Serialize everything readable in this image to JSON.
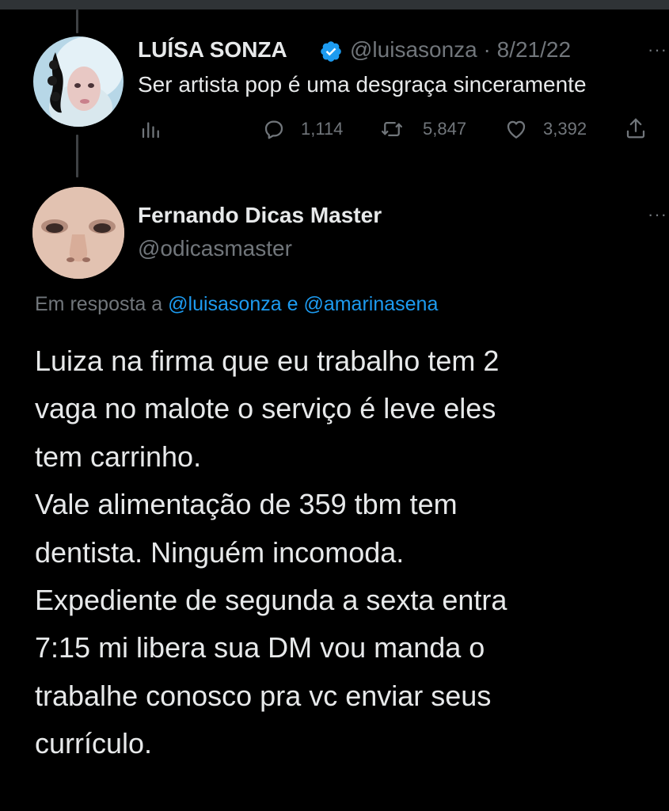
{
  "tweet1": {
    "name": "LUÍSA SONZA",
    "verified": true,
    "handle_date": "@luisasonza · 8/21/22",
    "more": "···",
    "text": "Ser artista pop é uma desgraça sinceramente",
    "stats": {
      "replies": "1,114",
      "retweets": "5,847",
      "likes": "3,392"
    },
    "icons": [
      "analytics-icon",
      "reply-icon",
      "retweet-icon",
      "like-icon",
      "share-icon"
    ]
  },
  "tweet2": {
    "name": "Fernando Dicas Master",
    "handle": "@odicasmaster",
    "more": "···",
    "reply_prefix": "Em resposta a ",
    "mention1": "@luisasonza",
    "reply_joiner": " e ",
    "mention2": "@amarinasena",
    "lines": [
      "Luiza na firma que eu trabalho tem 2",
      "vaga no malote o serviço é leve eles",
      "tem carrinho.",
      "Vale alimentação de 359 tbm tem",
      "dentista. Ninguém incomoda.",
      "Expediente de segunda a sexta entra",
      "7:15 mi libera sua DM vou manda o",
      "trabalhe conosco pra vc enviar seus",
      "currículo."
    ]
  },
  "colors": {
    "background": "#000000",
    "text": "#e7e9ea",
    "muted": "#71767b",
    "link": "#1d9bf0",
    "verified": "#1d9bf0"
  }
}
